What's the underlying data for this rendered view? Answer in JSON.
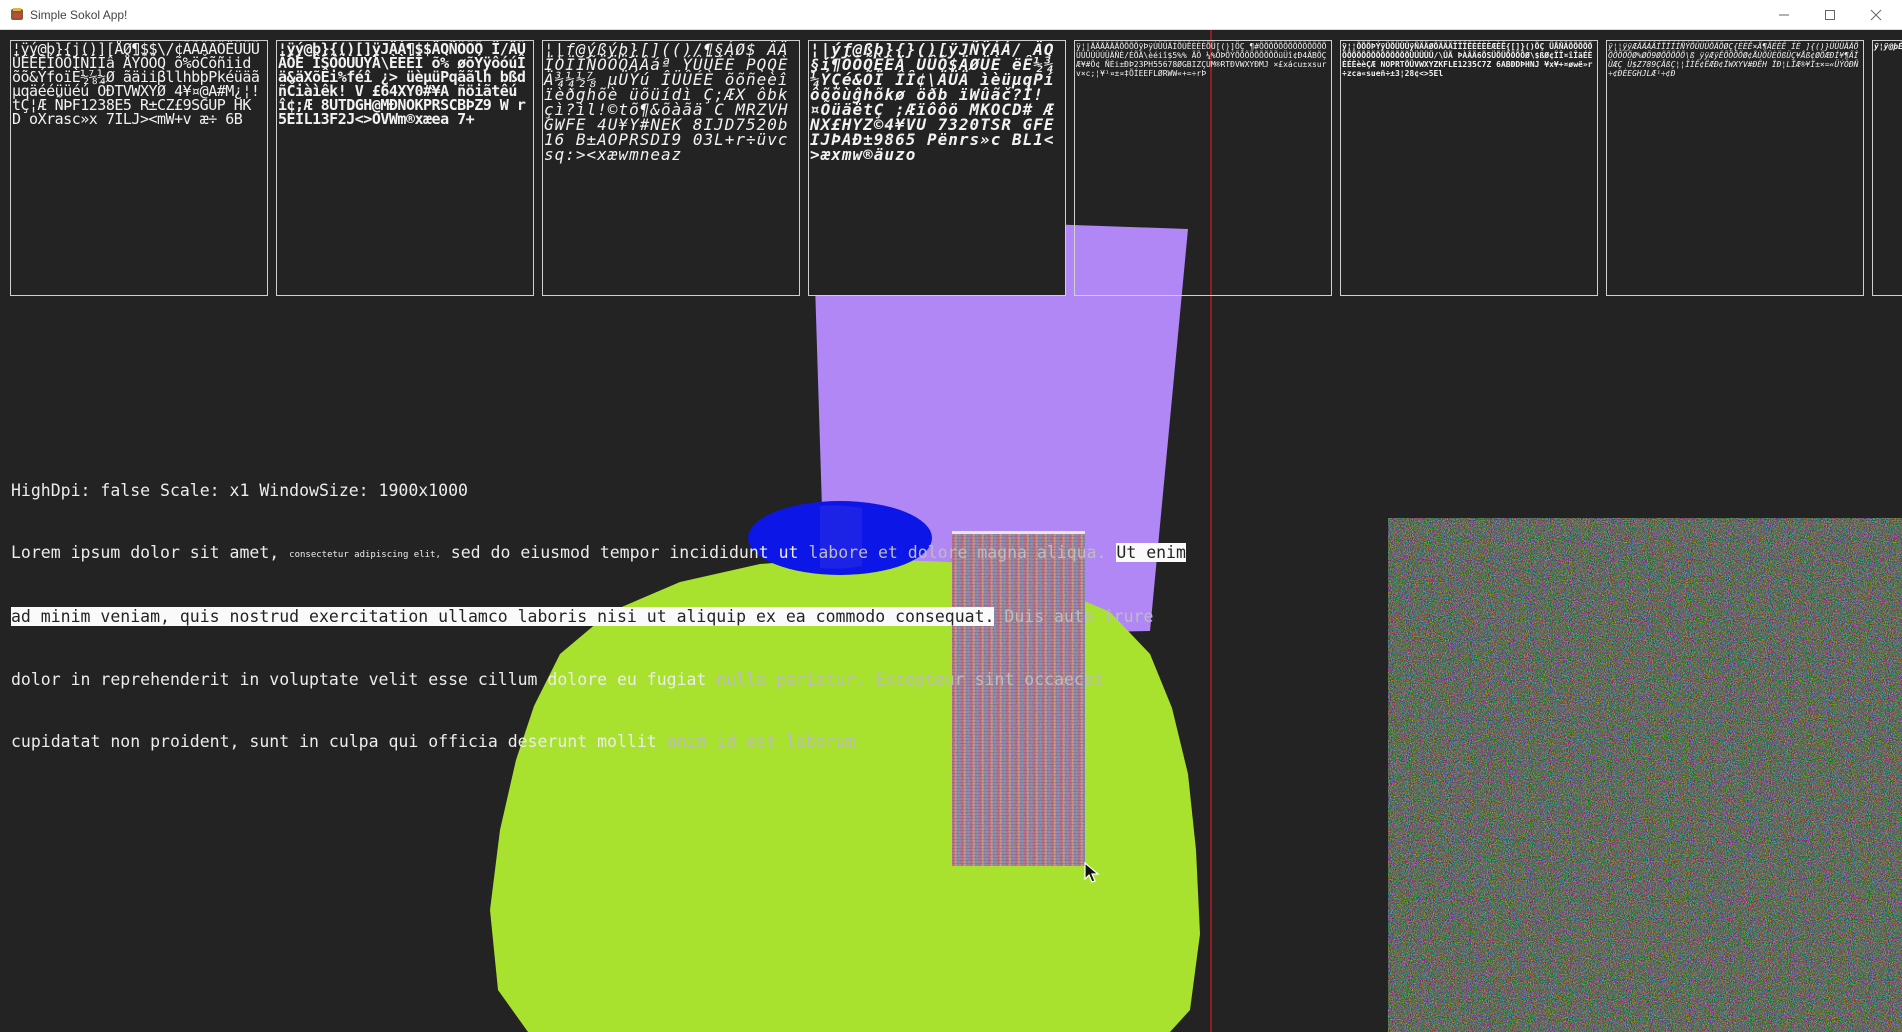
{
  "window": {
    "title": "Simple Sokol App!",
    "icons": {
      "app": "app-icon",
      "minimize": "minimize-icon",
      "maximize": "maximize-icon",
      "close": "close-icon"
    },
    "controls": {
      "minimize": "—",
      "maximize": "☐",
      "close": "✕"
    }
  },
  "atlases": [
    {
      "glyphs": "¦ÿý@þ}{j()][ÅØ¶$$\\/¢ÃÃÄÄÖÊÜÜÜÜÊÉÊÍÖÖÍÑÍÍâ ÅŸÖÖQ õ%öČõñiid õõ&ÝfoïÈ½⅞¼Ø ãäiiβllhbþPkéüäãµqäééüüéú ÕÐTVWXYØ 4¥¤@A#M¿¦!tÇ¦Æ ÑÞF1238E5 R±CZ£9SGUP HK D oXrasc»x 7ILJ><mW+v æ÷ 6B"
    },
    {
      "glyphs": "¦ÿý@þ}{()[]ÿJÄÁ¶$$ÄQÑÕÖÖ Î/ÄÜÄÖÈ ÎŠÕÕÙÛÝÄ\\ÈÈÉÎ õ% øõÝÿôóúÎä&äXõÊi%féî ¿> üèµüPqããlh bßdñČiàìêk! V £64XY0#¥A ñöiãtêúî¢;Æ 8UTDGH@MÐNOKPRSCBÞZ9 W r5EIL13F2J<>OVWm®xæea 7+"
    },
    {
      "glyphs": "¦|f@ýßýþ}[](()/¶§ÁØ$ ÄÄÏÕÏÍÑÖÖÖÄÂáª ÝÛÜÉÈ PQQÈÄ¾¼½⅞ µÜÝú ÎÜÛÉÈ õõñeèîïèðghõè üõüídì Ç;ÆX ôbkçì?ìl!©tõ¶&õàãä C MRZVHGWFE 4U¥Y#NEK 8IJD7520b16 B±AOPRSDI9 03L+r÷üvcsq:><xæwmneaz"
    },
    {
      "glyphs": "¦|ýƒ@ßþ}{}()[ÿJÑŸÁÁ/ ÄQ§í¶ÕÕÕÈÈÄ ÙÛÕ$ÄØÜÈ ëÊ½¾¼ÝÇé&ÕÏ ÎÎ¢\\ÄÜÄ ìèüµqPíôõõùĝhõkø öðb ïWûãč?Ì!¤ÕüäëtÇ ;Æïôôö MKOCD# ÆNX£HYZ©4¥VU 7320TSR GFEIJÞAÐ±9865 Pënrs»c BL1<>æxmw®äuzo"
    },
    {
      "glyphs": "ÿ¦|ÄÄÄÄÄÄÕÕÕÕÿÞÿÙÜÜÄÍÕÙÊÈÈÈÕÜ[()]ÖÇ ¶#ÕÕÕÕÕÕÕÕÕÕÕÕÕÕÜÜÜÜÜÚÜÄÑÈ/ÈÕÄ\\èéiî$5%% ÃÕ ¼%ÕÞÕÝÕÕÕÕÕÕÕÕÕüÜî¢Ð4ÄBÕÇ Æ¥#Õ¢ ÑÈi±ÐÞ23PH55678ØGBIZÇUM®RTÐVWXYÐMJ ×£xácu±xsurv×c;¦¥¹¤±¤‡ÕÍEEFLØRWW«+=÷rÞ"
    },
    {
      "glyphs": "ÿ¦¦ÕÕÕÞÝÿÜÕÜÜÜÿÑÄÄØÕÄÄÄÎÎÎÊÈÉÈÈÆÈÊ{[]}()ÕÇ ÜÅÑÄÕÕÕÕÕÕÕÕÕÕÕÕÕÕÕÕÕÕÕÜÜÜÜÜ/\\ÛÃ ÞÀÂÄ6ÕSÜÕÜÕÕÕÕØ\\$ßØ¢ÎÎ¤îÎäÉÈÈÉÈèèÇÆ NOPRTÕÜVWXYZKFLE1235C7Z 6ABÐDÞHNJ ¥x¥+¤øwë»r÷zca«sueñ÷±3¦28¢<>5El"
    },
    {
      "glyphs": "ÿ¦¦ÿÿÆÄÄÁÂÍÏÍÍÍÑÝÕÜÜÜÕÄÕØÇ{ÈÈÊ×Ä¶ÄÉÈÊ ÍÈ ]{()}ÜÜÜÄÄÕÕÕÕÕÕØ%ØÖ9ØÕÕÕÕÕ\\ß ÿÿÆÿÊÕÕÕÕØ¢ÅÙÕÜÈÖßÜÇ¥Åß¢ØÕÆÐÍ¥¶ÃÎ ÜÆÇ Ü$Z789ÇÃßÇ¦¦ÎÌÊ¢ËÆÐ¢ÏWXYV#ÐÊH ÏÐ¦LÏÆ®¥Ï±×=«ÜÝÖÐÑ÷¢ÐÈEGHJLÆ¹÷¢Ð"
    },
    {
      "glyphs": "ÿ¦ÿ@þÈÜÕÄÄÕ¶$ÿ Õ%ÕÕÕ#Õ¢ ÿ¢Õ¢"
    }
  ],
  "info": {
    "status": "HighDpi: false Scale: x1 WindowSize: 1900x1000",
    "para": {
      "s1": "Lorem ipsum dolor sit amet, ",
      "s2": "consectetur adipiscing elit,",
      "s3": " sed do eiusmod tempor incididunt ut ",
      "s4": "labore et dolore magna aliqua.",
      "s5": " ",
      "s6": "Ut enim",
      "s7": "ad minim veniam, quis nostrud exercitation ullamco laboris nisi ut aliquip ex ea commodo consequat.",
      "s8": " Duis aute irure",
      "s9": "dolor in reprehenderit in voluptate velit esse cillum dolore eu fugiat ",
      "s10": "nulla pariatur. Excepteur sint occaecat",
      "s11": "cupidatat non proident, sunt in culpa qui officia deserunt mollit ",
      "s12": "anim id est laborum"
    }
  },
  "scene": {
    "background": "#232323",
    "shapes": [
      "green-sphere",
      "purple-quad",
      "blue-ellipse",
      "rainbow-texture-quad",
      "noise-texture-quad",
      "red-vertical-line"
    ],
    "colors": {
      "green": "#a8e22e",
      "purple": "#b186f5",
      "blue": "#0c16e6",
      "red": "#d21d1d"
    }
  }
}
